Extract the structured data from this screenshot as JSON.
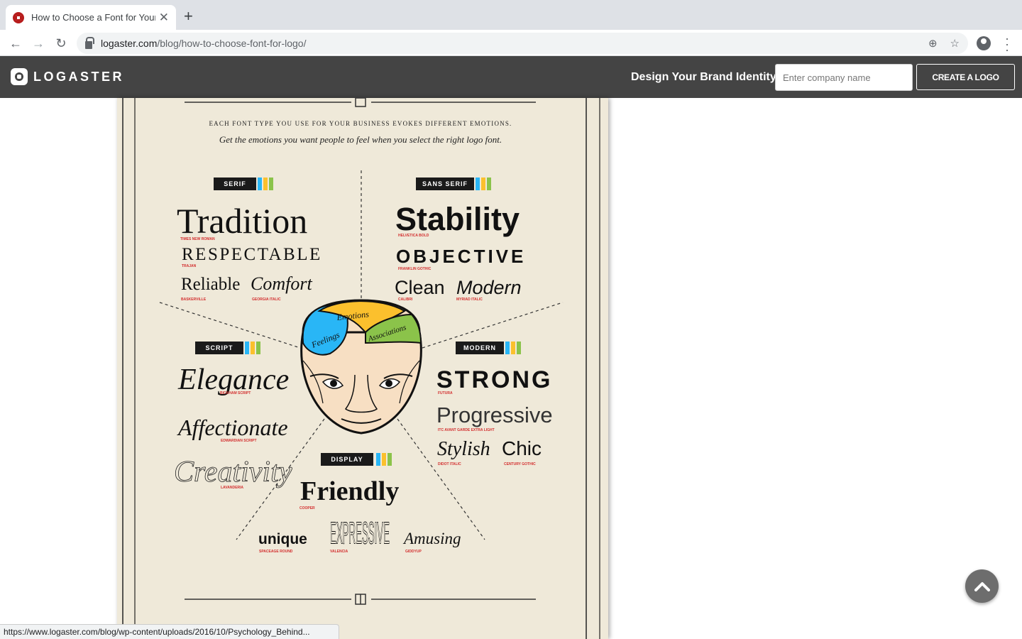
{
  "browser": {
    "tab_title": "How to Choose a Font for Your",
    "tab_close": "✕",
    "new_tab": "+",
    "url_domain": "logaster.com",
    "url_path": "/blog/how-to-choose-font-for-logo/",
    "status_url": "https://www.logaster.com/blog/wp-content/uploads/2016/10/Psychology_Behind..."
  },
  "header": {
    "brand": "LOGASTER",
    "tagline": "Design Your Brand Identity",
    "input_placeholder": "Enter company name",
    "cta": "CREATE A LOGO"
  },
  "poster": {
    "intro_caps": "EACH FONT TYPE YOU USE FOR YOUR BUSINESS EVOKES DIFFERENT EMOTIONS.",
    "intro_italic": "Get the emotions you want people to feel when you select the right logo font.",
    "serif": {
      "badge": "SERIF",
      "w1": "Tradition",
      "f1": "TIMES NEW ROMAN",
      "w2": "RESPECTABLE",
      "f2": "TRAJAN",
      "w3": "Reliable",
      "f3": "BASKERVILLE",
      "w4": "Comfort",
      "f4": "GEORGIA ITALIC"
    },
    "sans": {
      "badge": "SANS SERIF",
      "w1": "Stability",
      "f1": "HELVETICA BOLD",
      "w2": "OBJECTIVE",
      "f2": "FRANKLIN GOTHIC",
      "w3": "Clean",
      "f3": "CALIBRI",
      "w4": "Modern",
      "f4": "MYRIAD ITALIC"
    },
    "script": {
      "badge": "SCRIPT",
      "w1": "Elegance",
      "f1": "BICKHAM SCRIPT",
      "w2": "Affectionate",
      "f2": "EDWARDIAN SCRIPT",
      "w3": "Creativity",
      "f3": "LAVANDERIA"
    },
    "modern": {
      "badge": "MODERN",
      "w1": "STRONG",
      "f1": "FUTURA",
      "w2": "Progressive",
      "f2": "ITC AVANT GARDE EXTRA LIGHT",
      "w3": "Stylish",
      "f3": "DIDOT ITALIC",
      "w4": "Chic",
      "f4": "CENTURY GOTHIC"
    },
    "display": {
      "badge": "DISPLAY",
      "w1": "Friendly",
      "f1": "COOPER",
      "w2": "unique",
      "f2": "SPACEAGE ROUND",
      "w3": "EXPRESSIVE",
      "f3": "VALENCIA",
      "w4": "Amusing",
      "f4": "GIDDYUP"
    },
    "brain": {
      "left": "Feelings",
      "top": "Emotions",
      "right": "Associations"
    }
  },
  "colors": {
    "header_bg": "#444444",
    "poster_bg": "#efe9d9",
    "label_red": "#d32f2f",
    "brain_blue": "#29b6f6",
    "brain_yellow": "#fbc02d",
    "brain_green": "#8bc34a"
  }
}
